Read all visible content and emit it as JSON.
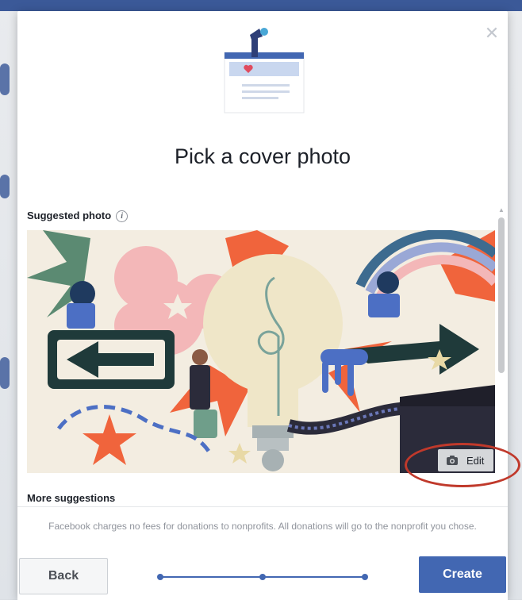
{
  "modal": {
    "title": "Pick a cover photo",
    "close_icon": "close-icon"
  },
  "suggested": {
    "label": "Suggested photo",
    "info_glyph": "i",
    "edit_label": "Edit",
    "edit_icon": "camera-icon"
  },
  "more": {
    "label": "More suggestions"
  },
  "footer": {
    "note": "Facebook charges no fees for donations to nonprofits. All donations will go to the nonprofit you chose.",
    "back_label": "Back",
    "create_label": "Create",
    "progress_steps": 3
  },
  "colors": {
    "brand_blue": "#4267b2",
    "annotation_red": "#c0392b"
  }
}
